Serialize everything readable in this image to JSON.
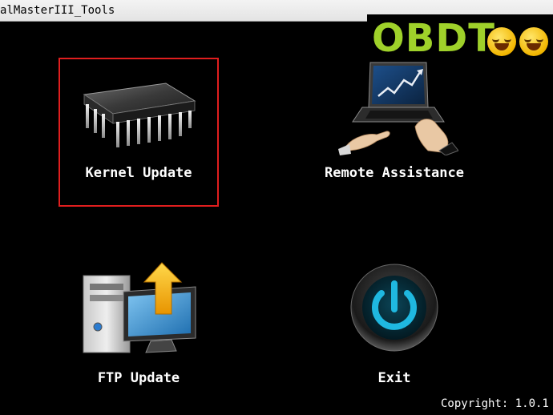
{
  "window": {
    "title": "alMasterIII_Tools"
  },
  "watermark": {
    "text": "OBDT"
  },
  "tools": {
    "kernel_update": {
      "label": "Kernel Update",
      "icon": "cpu-chip-icon"
    },
    "remote_assistance": {
      "label": "Remote Assistance",
      "icon": "laptop-hands-icon"
    },
    "ftp_update": {
      "label": "FTP Update",
      "icon": "computer-upload-icon"
    },
    "exit": {
      "label": "Exit",
      "icon": "power-icon"
    }
  },
  "footer": {
    "copyright": "Copyright: 1.0.1"
  },
  "colors": {
    "background": "#000000",
    "selection": "#e01e1e",
    "logo": "#9fd12a",
    "power_glow": "#1fb8e0"
  }
}
